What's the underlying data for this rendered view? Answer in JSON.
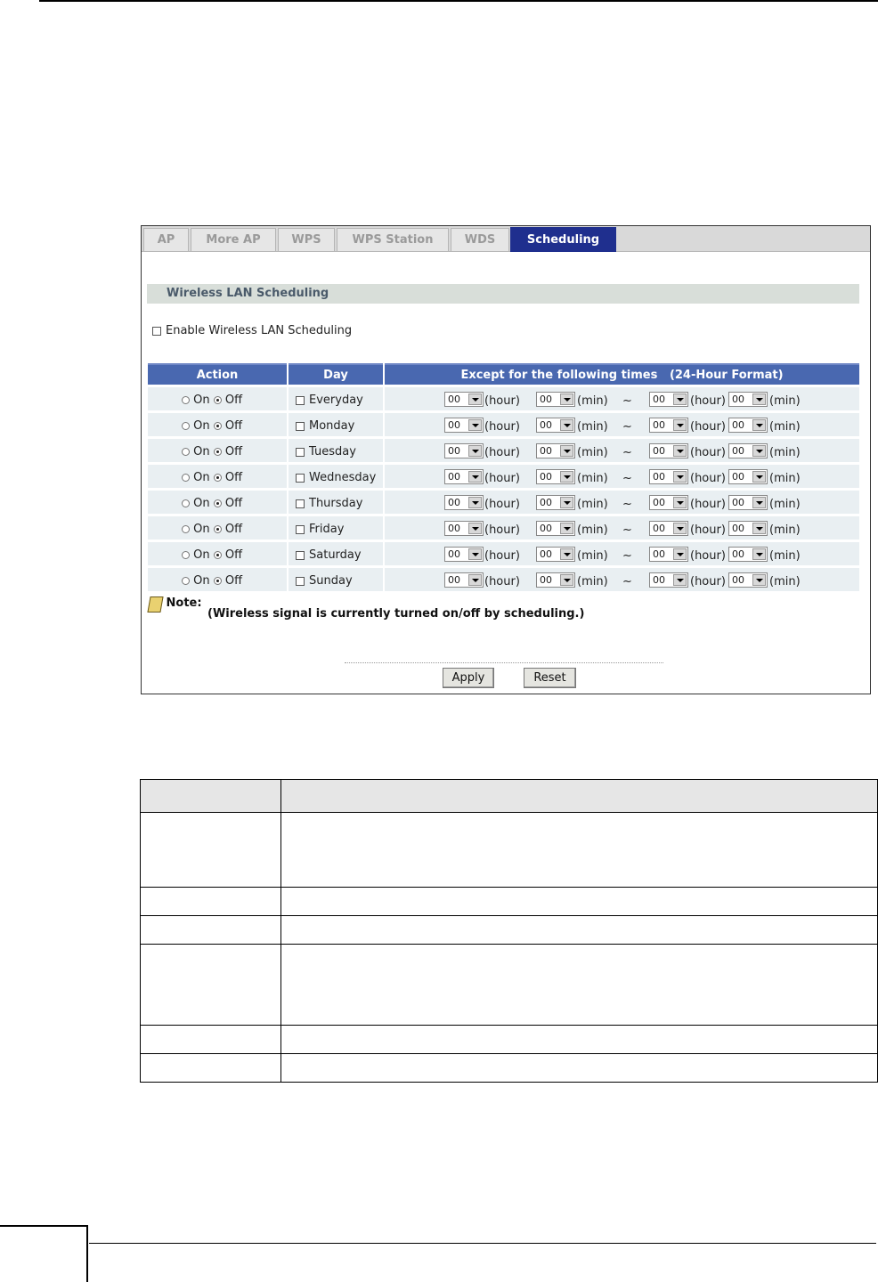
{
  "tabs": [
    "AP",
    "More AP",
    "WPS",
    "WPS Station",
    "WDS",
    "Scheduling"
  ],
  "active_tab": "Scheduling",
  "section_title": "Wireless LAN Scheduling",
  "enable_label": "Enable Wireless LAN Scheduling",
  "columns": {
    "action": "Action",
    "day": "Day",
    "except": "Except for the following times   (24-Hour Format)"
  },
  "radio_labels": {
    "on": "On",
    "off": "Off"
  },
  "time_labels": {
    "hour": "(hour)",
    "min": "(min)",
    "tilde": "~"
  },
  "time_value": "00",
  "rows": [
    {
      "day": "Everyday",
      "action": "Off"
    },
    {
      "day": "Monday",
      "action": "Off"
    },
    {
      "day": "Tuesday",
      "action": "Off"
    },
    {
      "day": "Wednesday",
      "action": "Off"
    },
    {
      "day": "Thursday",
      "action": "Off"
    },
    {
      "day": "Friday",
      "action": "Off"
    },
    {
      "day": "Saturday",
      "action": "Off"
    },
    {
      "day": "Sunday",
      "action": "Off"
    }
  ],
  "note": {
    "label": "Note:",
    "text": "(Wireless signal is currently turned on/off by scheduling.)"
  },
  "buttons": {
    "apply": "Apply",
    "reset": "Reset"
  },
  "colors": {
    "tab_active": "#1f2f8e",
    "header": "#4968b0",
    "row_bg": "#e9eff2",
    "section_bg": "#d8ded9"
  }
}
